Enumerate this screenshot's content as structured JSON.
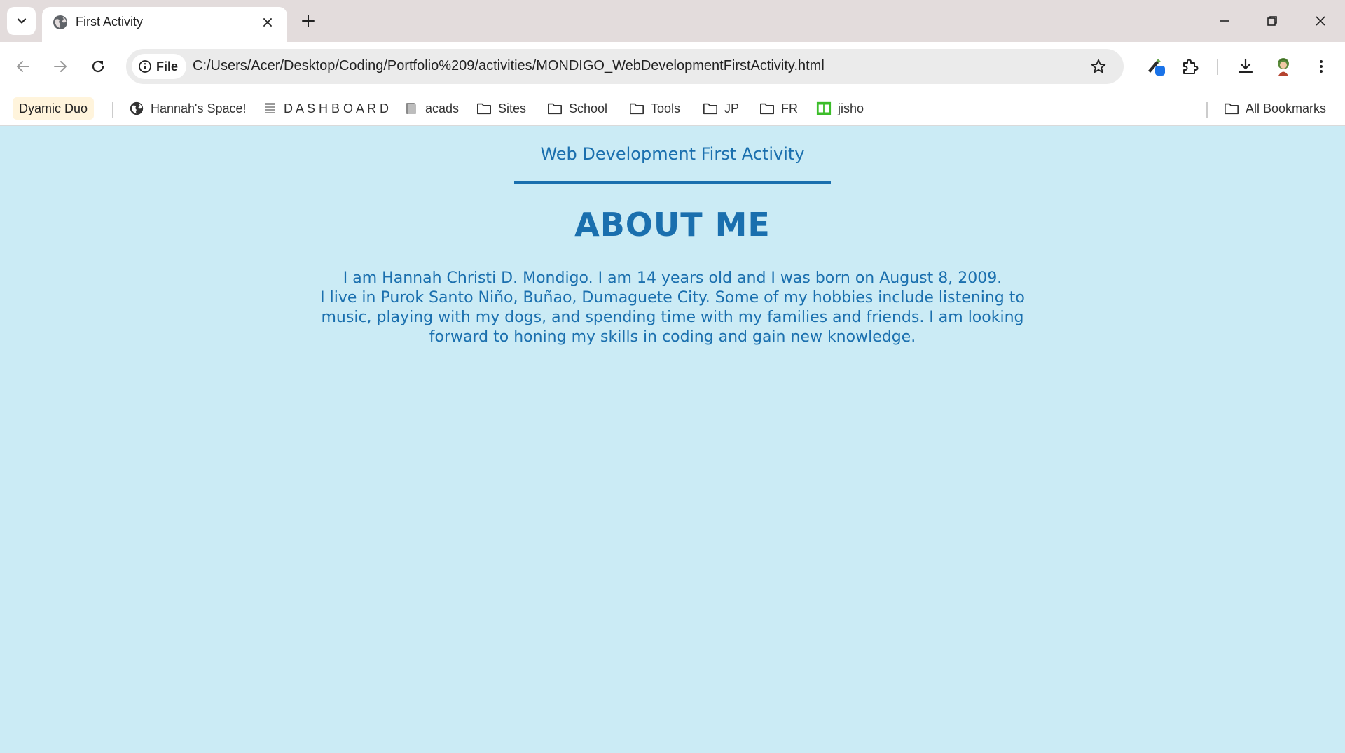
{
  "browser": {
    "tab": {
      "title": "First Activity"
    },
    "omnibox": {
      "chip_label": "File",
      "url": "C:/Users/Acer/Desktop/Coding/Portfolio%209/activities/MONDIGO_WebDevelopmentFirstActivity.html"
    },
    "bookmarks": [
      {
        "label": "Dyamic Duo",
        "icon": "none"
      },
      {
        "label": "Hannah's Space!",
        "icon": "globe-icon"
      },
      {
        "label": "D A S H B O A R D",
        "icon": "list-icon"
      },
      {
        "label": "acads",
        "icon": "book-icon"
      },
      {
        "label": "Sites",
        "icon": "folder-icon"
      },
      {
        "label": "School",
        "icon": "folder-icon"
      },
      {
        "label": "Tools",
        "icon": "folder-icon"
      },
      {
        "label": "JP",
        "icon": "folder-icon"
      },
      {
        "label": "FR",
        "icon": "folder-icon"
      },
      {
        "label": "jisho",
        "icon": "jisho-icon"
      }
    ],
    "all_bookmarks_label": "All Bookmarks"
  },
  "page": {
    "header_title": "Web Development First Activity",
    "heading": "ABOUT ME",
    "paragraph_line1": "I am Hannah Christi D. Mondigo. I am 14 years old and I was born on August 8, 2009.",
    "paragraph_rest": "I live in Purok Santo Niño, Buñao, Dumaguete City. Some of my hobbies include listening to music, playing with my dogs, and spending time with my families and friends. I am looking forward to honing my skills in coding and gain new knowledge."
  },
  "colors": {
    "page_background": "#cbebf5",
    "page_text": "#1a6fae",
    "tabstrip": "#e3dcdc"
  }
}
